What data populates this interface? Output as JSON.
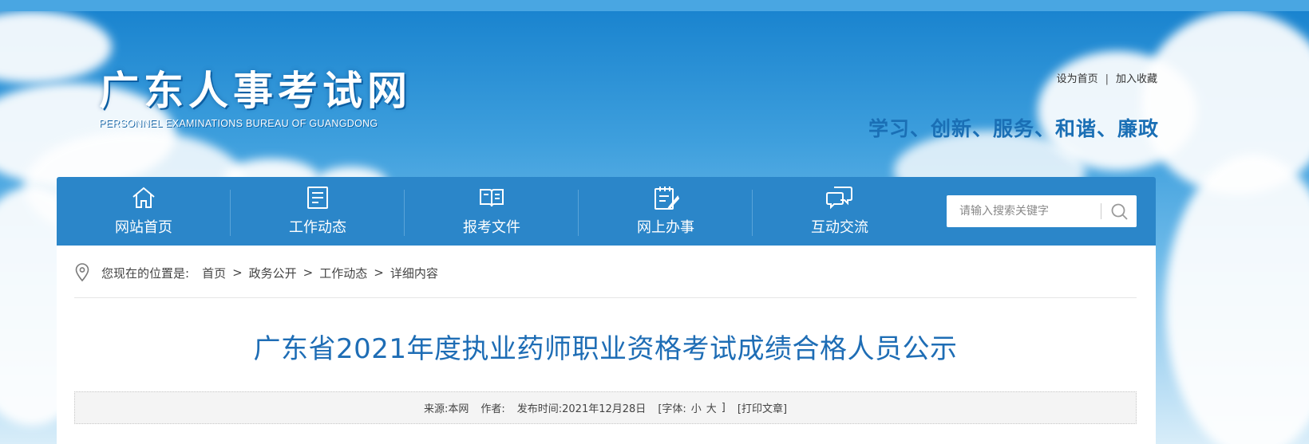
{
  "header": {
    "logo_title": "广东人事考试网",
    "logo_subtitle": "PERSONNEL EXAMINATIONS BUREAU OF GUANGDONG",
    "top_links": {
      "set_home": "设为首页",
      "separator": "|",
      "add_favorite": "加入收藏"
    },
    "slogan": "学习、创新、服务、和谐、廉政"
  },
  "nav": {
    "items": [
      {
        "label": "网站首页",
        "icon": "home-icon"
      },
      {
        "label": "工作动态",
        "icon": "document-list-icon"
      },
      {
        "label": "报考文件",
        "icon": "open-book-icon"
      },
      {
        "label": "网上办事",
        "icon": "clipboard-edit-icon"
      },
      {
        "label": "互动交流",
        "icon": "chat-bubbles-icon"
      }
    ],
    "search": {
      "placeholder": "请输入搜索关键字",
      "value": "",
      "button_icon": "search-icon"
    }
  },
  "breadcrumb": {
    "lead": "您现在的位置是:",
    "items": [
      "首页",
      "政务公开",
      "工作动态",
      "详细内容"
    ],
    "separator": ">"
  },
  "article": {
    "title": "广东省2021年度执业药师职业资格考试成绩合格人员公示",
    "meta": {
      "source": "来源:本网",
      "author": "作者:",
      "publish_time": "发布时间:2021年12月28日",
      "font_open": "[字体:",
      "font_small": "小",
      "font_large": "大",
      "font_close": "]",
      "print": "[打印文章]"
    }
  },
  "colors": {
    "nav_bg": "#2b86c9",
    "title_blue": "#1e6db5",
    "slogan_blue": "#1a6fb5",
    "top_strip": "#49a6e2"
  }
}
